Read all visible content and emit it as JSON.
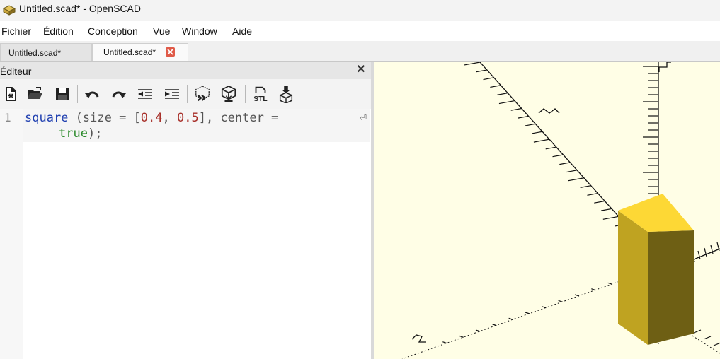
{
  "window": {
    "title": "Untitled.scad* - OpenSCAD",
    "icon": "openscad-logo-icon"
  },
  "menu": [
    {
      "label": "Fichier"
    },
    {
      "label": "Édition"
    },
    {
      "label": "Conception"
    },
    {
      "label": "Vue"
    },
    {
      "label": "Window"
    },
    {
      "label": "Aide"
    }
  ],
  "tabs": [
    {
      "label": "Untitled.scad*",
      "active": false
    },
    {
      "label": "Untitled.scad*",
      "active": true
    }
  ],
  "editor": {
    "title": "Éditeur",
    "toolbar": [
      {
        "icon": "new-file-icon"
      },
      {
        "icon": "open-file-icon"
      },
      {
        "icon": "save-icon"
      },
      {
        "icon": "undo-icon"
      },
      {
        "icon": "redo-icon"
      },
      {
        "icon": "unindent-icon"
      },
      {
        "icon": "indent-icon"
      },
      {
        "icon": "preview-icon"
      },
      {
        "icon": "render-icon"
      },
      {
        "icon": "export-stl-icon",
        "text": "STL"
      },
      {
        "icon": "send-to-print-icon"
      }
    ],
    "line_number": "1",
    "code": {
      "fn": "square",
      "open": " (size = [",
      "n1": "0.4",
      "comma": ", ",
      "n2": "0.5",
      "mid": "], center =",
      "bool": "true",
      "end": ");"
    }
  },
  "colors": {
    "viewport_bg": "#fffee6",
    "object_top": "#fdd835",
    "object_left": "#bfa321",
    "object_right": "#6e5f14",
    "tab_close": "#e05a48"
  }
}
